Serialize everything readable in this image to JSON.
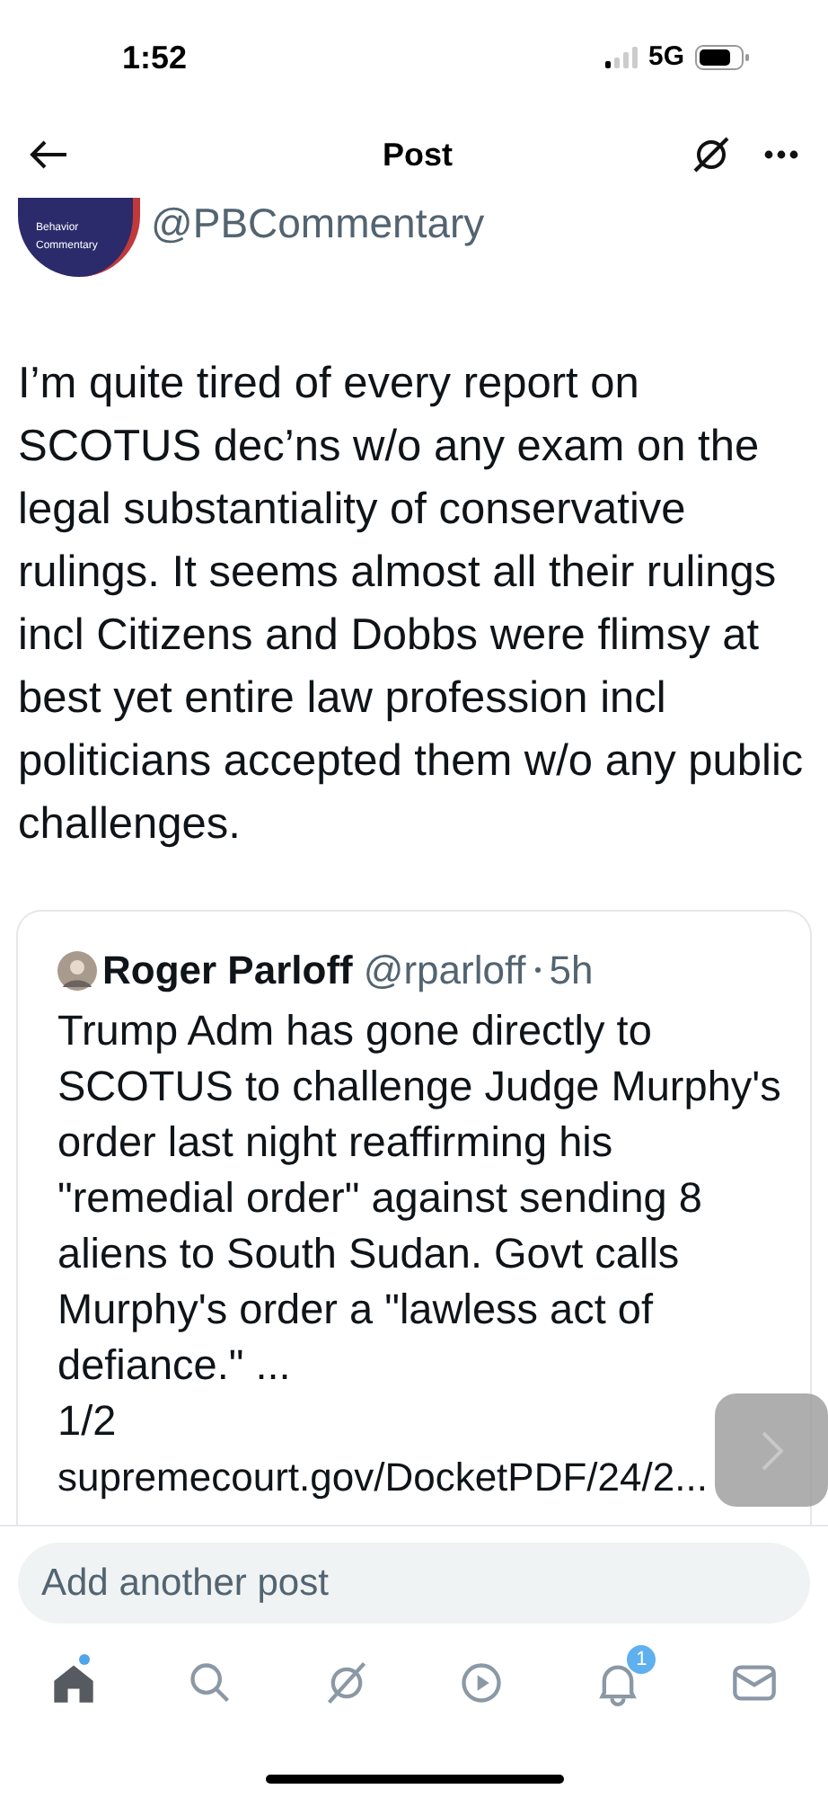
{
  "status_bar": {
    "time": "1:52",
    "network": "5G"
  },
  "header": {
    "title": "Post"
  },
  "author": {
    "handle": "@PBCommentary",
    "avatar_lines": [
      "Behavior",
      "Commentary"
    ]
  },
  "post": {
    "text": "I’m quite tired of every report on SCOTUS dec’ns w/o any exam on the legal substantiality of conservative rulings. It seems almost all their rulings incl Citizens and Dobbs were flimsy at best yet entire law profession incl politicians accepted them w/o any public challenges."
  },
  "quote": {
    "name": "Roger Parloff",
    "handle": "@rparloff",
    "time": "5h",
    "text": "Trump Adm has gone directly to SCOTUS to challenge Judge Murphy's order last night reaffirming his \"remedial order\" against sending 8 aliens to South Sudan. Govt calls Murphy's order a \"lawless act of defiance.\" ...",
    "counter": "1/2",
    "link": "supremecourt.gov/DocketPDF/24/2..."
  },
  "compose": {
    "placeholder": "Add another post"
  },
  "tab_bar": [
    {
      "kind": "home",
      "selected": true,
      "dot": true
    },
    {
      "kind": "search",
      "selected": false
    },
    {
      "kind": "grok",
      "selected": false
    },
    {
      "kind": "video",
      "selected": false
    },
    {
      "kind": "notifications",
      "selected": false,
      "badge": "1"
    },
    {
      "kind": "messages",
      "selected": false
    }
  ]
}
